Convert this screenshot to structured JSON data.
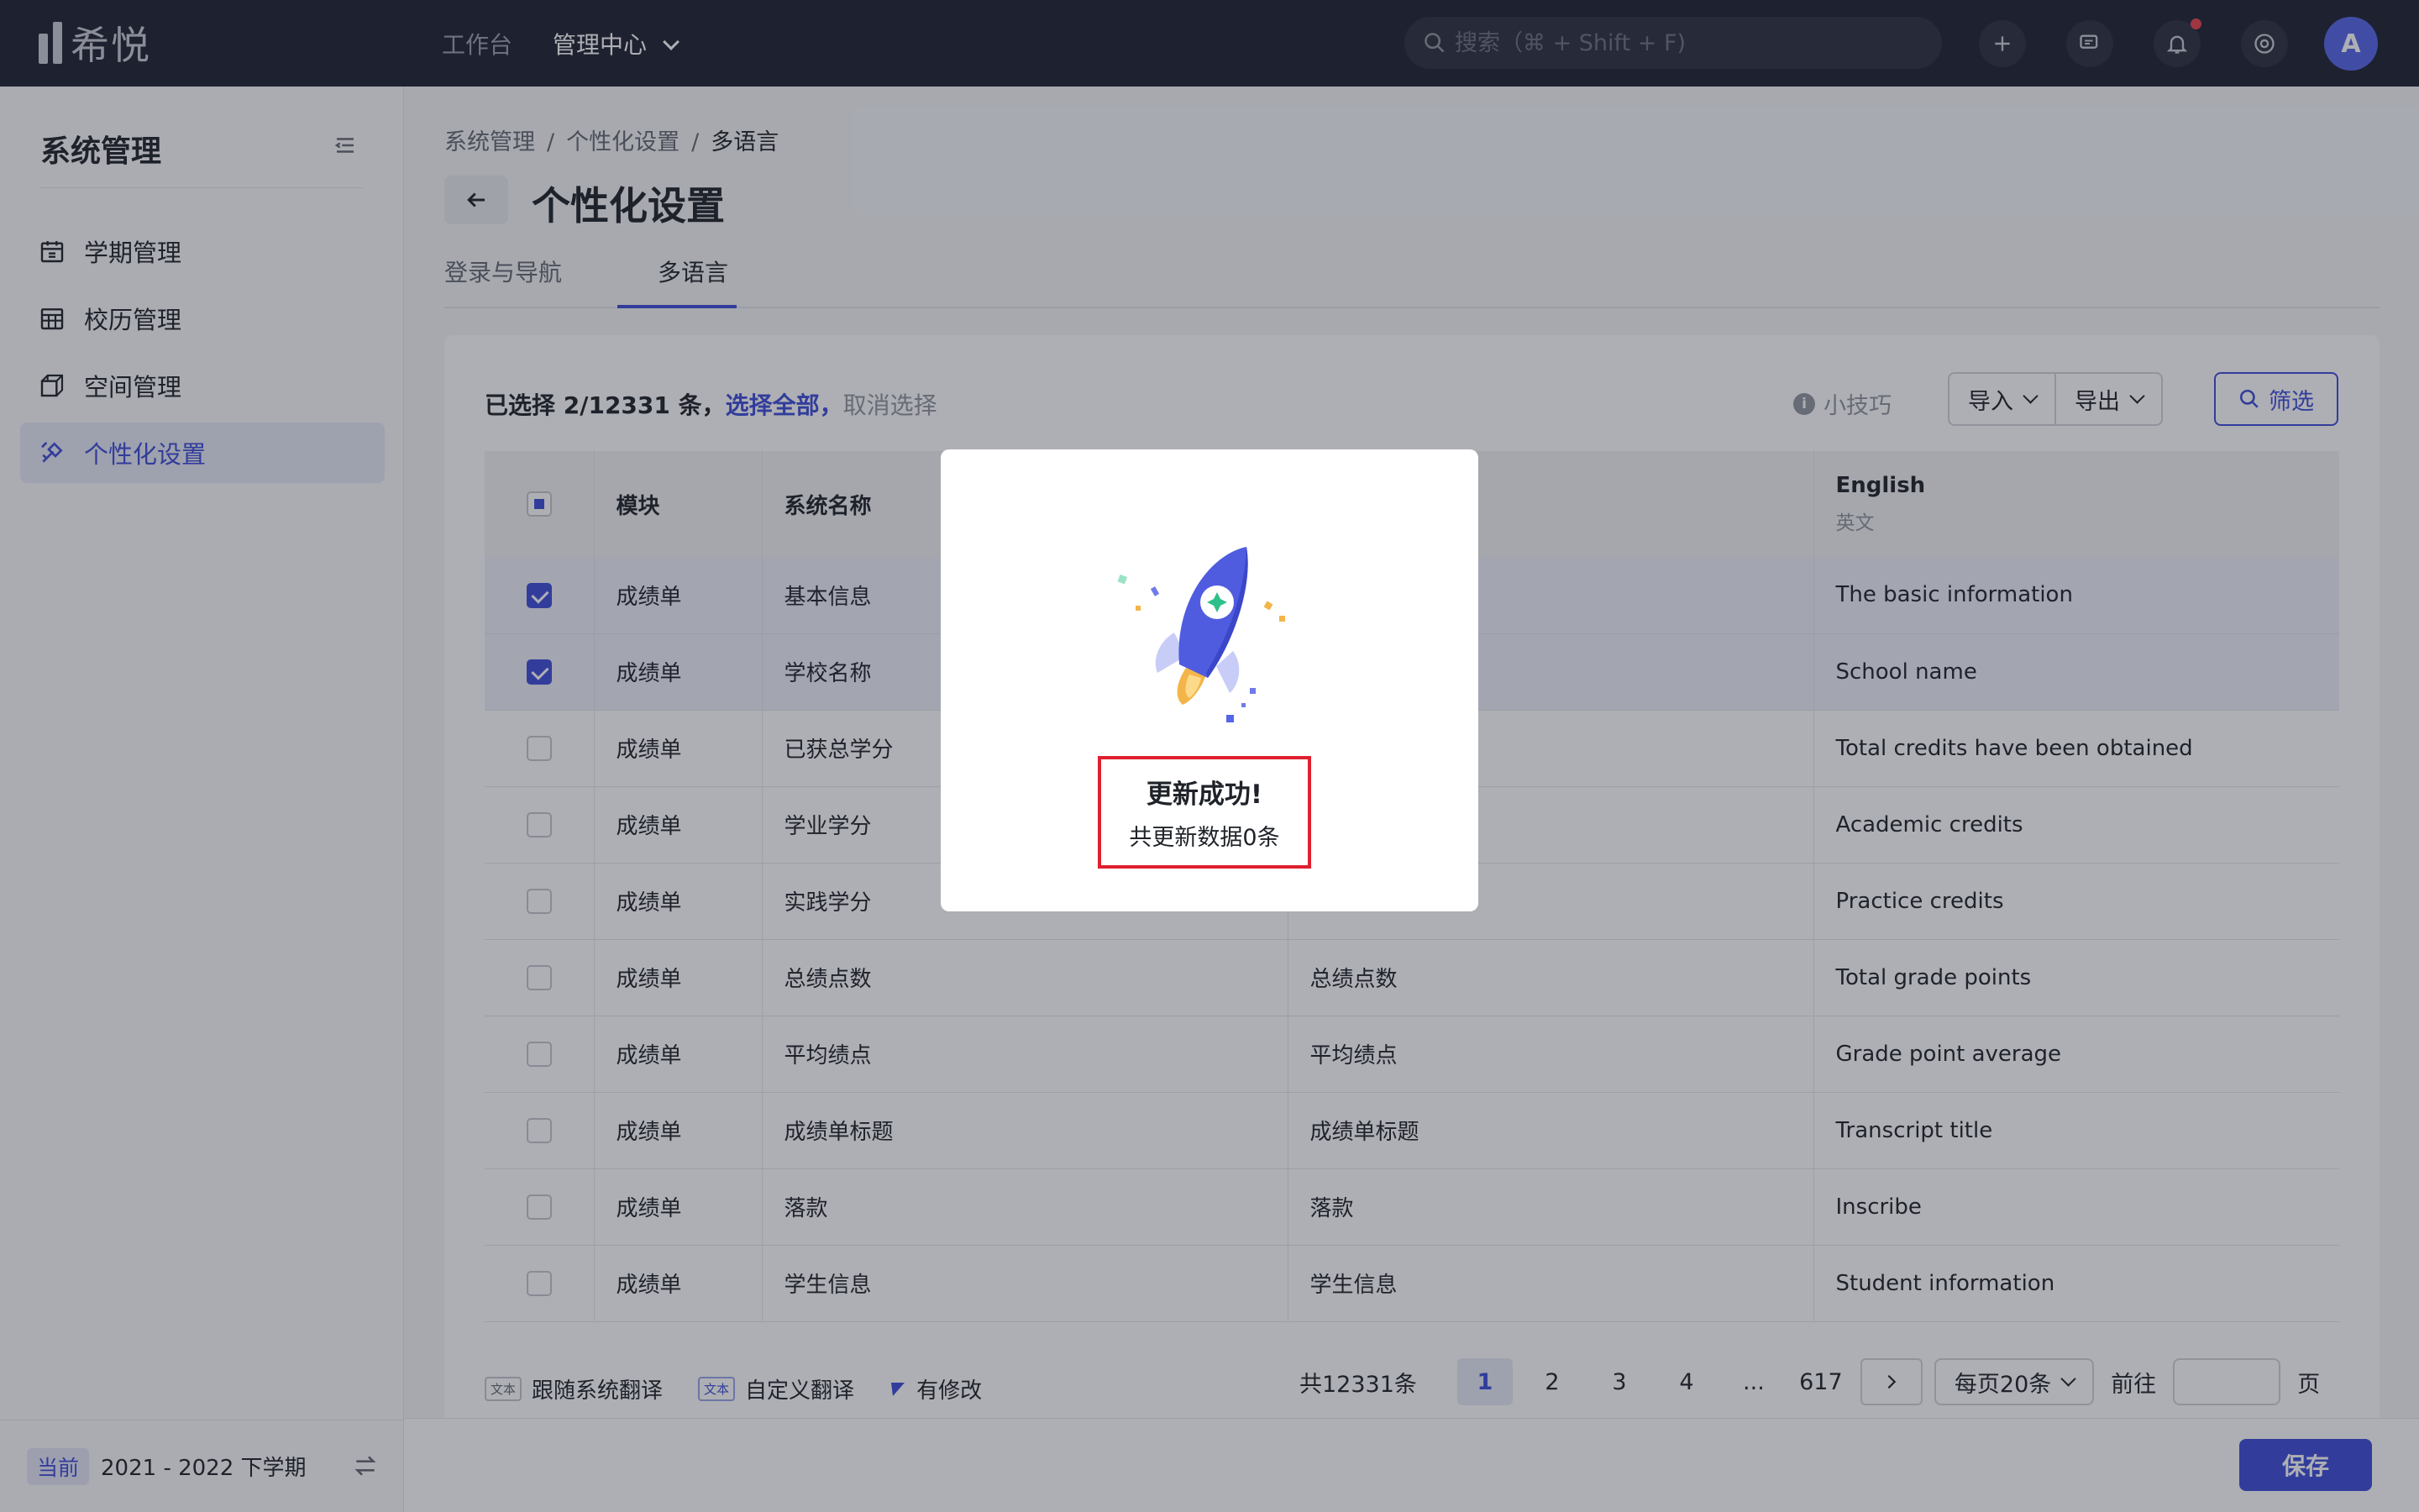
{
  "topbar": {
    "logo_text": "希悦",
    "nav": [
      "工作台",
      "管理中心"
    ],
    "search_placeholder": "搜索（⌘ + Shift + F)",
    "avatar_letter": "A",
    "icons": [
      "plus-icon",
      "chat-icon",
      "bell-icon",
      "settings-circle-icon"
    ]
  },
  "sidebar": {
    "title": "系统管理",
    "items": [
      {
        "label": "学期管理",
        "icon": "calendar-icon"
      },
      {
        "label": "校历管理",
        "icon": "grid-calendar-icon"
      },
      {
        "label": "空间管理",
        "icon": "cube-icon"
      },
      {
        "label": "个性化设置",
        "icon": "brush-icon",
        "active": true
      }
    ],
    "term_tag": "当前",
    "term_label": "2021 - 2022 下学期"
  },
  "breadcrumb": [
    "系统管理",
    "个性化设置",
    "多语言"
  ],
  "page_title": "个性化设置",
  "tabs": [
    "登录与导航",
    "多语言"
  ],
  "toolbar": {
    "selected_text": "已选择 2/12331 条，",
    "select_all": "选择全部，",
    "cancel_select": "取消选择",
    "tips": "小技巧",
    "import": "导入",
    "export": "导出",
    "filter": "筛选"
  },
  "table": {
    "headers": [
      "模块",
      "系统名称",
      "",
      "English"
    ],
    "header_sub_english": "英文",
    "rows": [
      {
        "module": "成绩单",
        "name": "基本信息",
        "custom": "",
        "english": "The basic information",
        "checked": true
      },
      {
        "module": "成绩单",
        "name": "学校名称",
        "custom": "",
        "english": "School name",
        "checked": true
      },
      {
        "module": "成绩单",
        "name": "已获总学分",
        "custom": "",
        "english": "Total credits have been obtained",
        "checked": false
      },
      {
        "module": "成绩单",
        "name": "学业学分",
        "custom": "",
        "english": "Academic credits",
        "checked": false
      },
      {
        "module": "成绩单",
        "name": "实践学分",
        "custom": "",
        "english": "Practice credits",
        "checked": false
      },
      {
        "module": "成绩单",
        "name": "总绩点数",
        "custom": "总绩点数",
        "english": "Total grade points",
        "checked": false
      },
      {
        "module": "成绩单",
        "name": "平均绩点",
        "custom": "平均绩点",
        "english": "Grade point average",
        "checked": false
      },
      {
        "module": "成绩单",
        "name": "成绩单标题",
        "custom": "成绩单标题",
        "english": "Transcript title",
        "checked": false
      },
      {
        "module": "成绩单",
        "name": "落款",
        "custom": "落款",
        "english": "Inscribe",
        "checked": false
      },
      {
        "module": "成绩单",
        "name": "学生信息",
        "custom": "学生信息",
        "english": "Student information",
        "checked": false
      }
    ]
  },
  "legend": {
    "badge_text": "文本",
    "follow": "跟随系统翻译",
    "custom": "自定义翻译",
    "modified": "有修改"
  },
  "pager": {
    "total": "共12331条",
    "pages": [
      "1",
      "2",
      "3",
      "4",
      "...",
      "617"
    ],
    "page_size": "每页20条",
    "goto": "前往",
    "page_unit": "页"
  },
  "footer": {
    "save": "保存"
  },
  "modal": {
    "title": "更新成功!",
    "subtitle": "共更新数据0条"
  },
  "colors": {
    "accent": "#3d4ed8",
    "highlight_border": "#e0202f",
    "topbar": "#1e2230"
  }
}
